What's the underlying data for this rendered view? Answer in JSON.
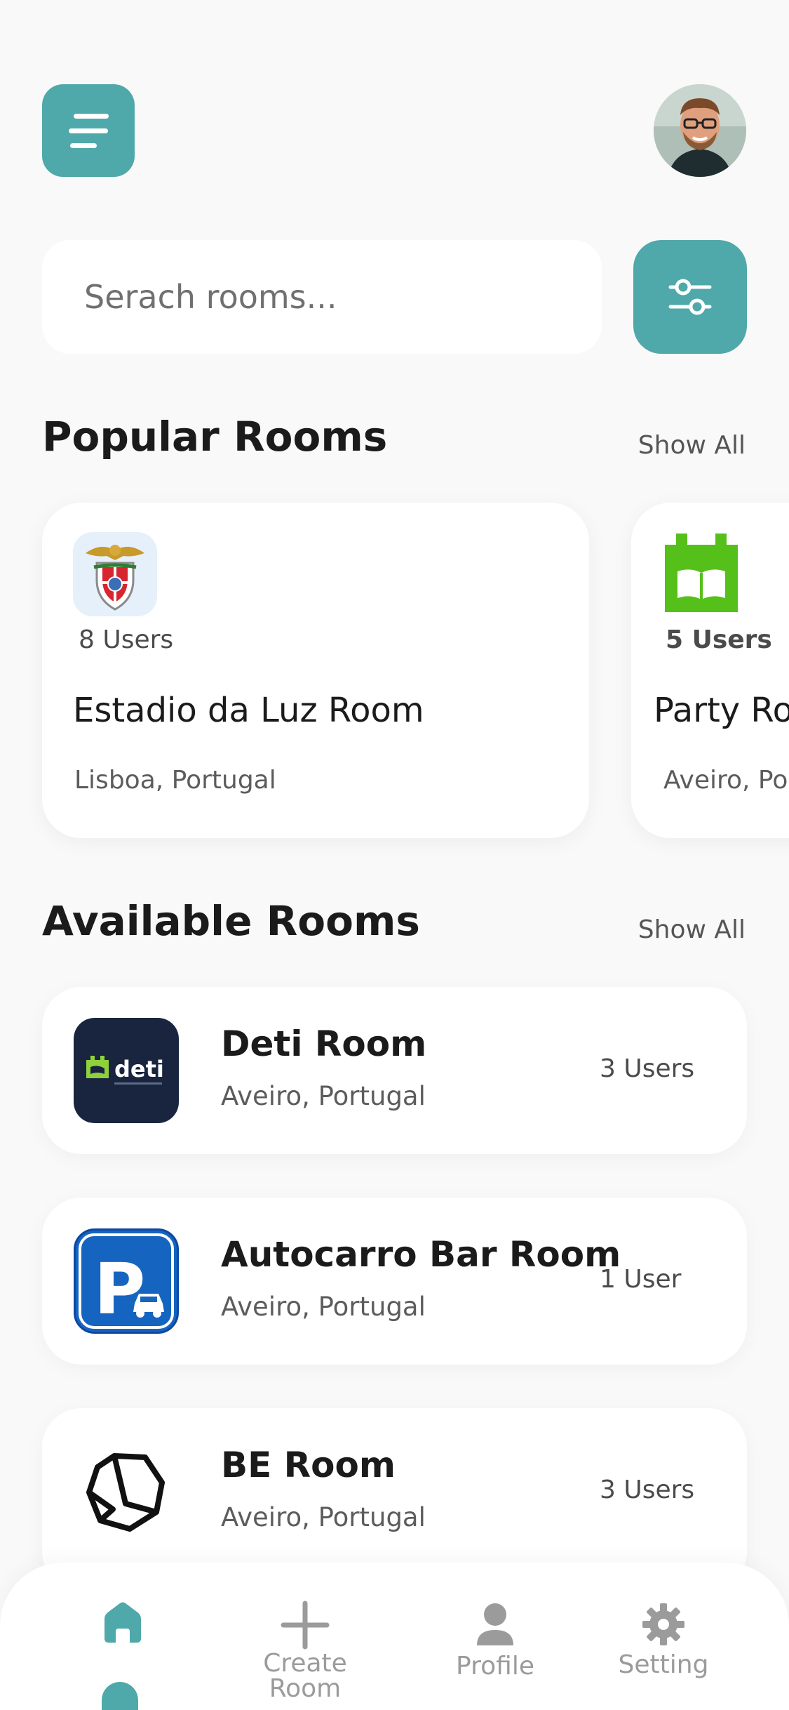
{
  "header": {
    "menu_icon": "hamburger-icon",
    "avatar_icon": "user-avatar"
  },
  "search": {
    "placeholder": "Serach rooms...",
    "filter_icon": "sliders-icon"
  },
  "popular": {
    "title": "Popular Rooms",
    "show_all": "Show All",
    "rooms": [
      {
        "users": "8 Users",
        "name": "Estadio da Luz Room",
        "location": "Lisboa, Portugal",
        "logo": "benfica-crest"
      },
      {
        "users": "5 Users",
        "name": "Party Ro",
        "location": "Aveiro, Por",
        "logo": "castle-book-logo"
      }
    ]
  },
  "available": {
    "title": "Available Rooms",
    "show_all": "Show All",
    "rooms": [
      {
        "name": "Deti Room",
        "location": "Aveiro, Portugal",
        "users": "3 Users",
        "logo": "deti-logo",
        "logo_text": "deti"
      },
      {
        "name": "Autocarro Bar Room",
        "location": "Aveiro, Portugal",
        "users": "1 User",
        "logo": "parking-sign"
      },
      {
        "name": "BE Room",
        "location": "Aveiro, Portugal",
        "users": "3 Users",
        "logo": "hexagon-logo"
      }
    ]
  },
  "nav": {
    "items": [
      {
        "label": "",
        "icon": "home-icon",
        "active": true
      },
      {
        "label_line1": "Create",
        "label_line2": "Room",
        "icon": "plus-icon"
      },
      {
        "label": "Profile",
        "icon": "person-icon"
      },
      {
        "label": "Setting",
        "icon": "gear-icon"
      }
    ]
  },
  "colors": {
    "accent": "#4fa8a9",
    "background": "#f9f9f9",
    "card": "#ffffff",
    "muted_text": "#9b9b9b"
  }
}
